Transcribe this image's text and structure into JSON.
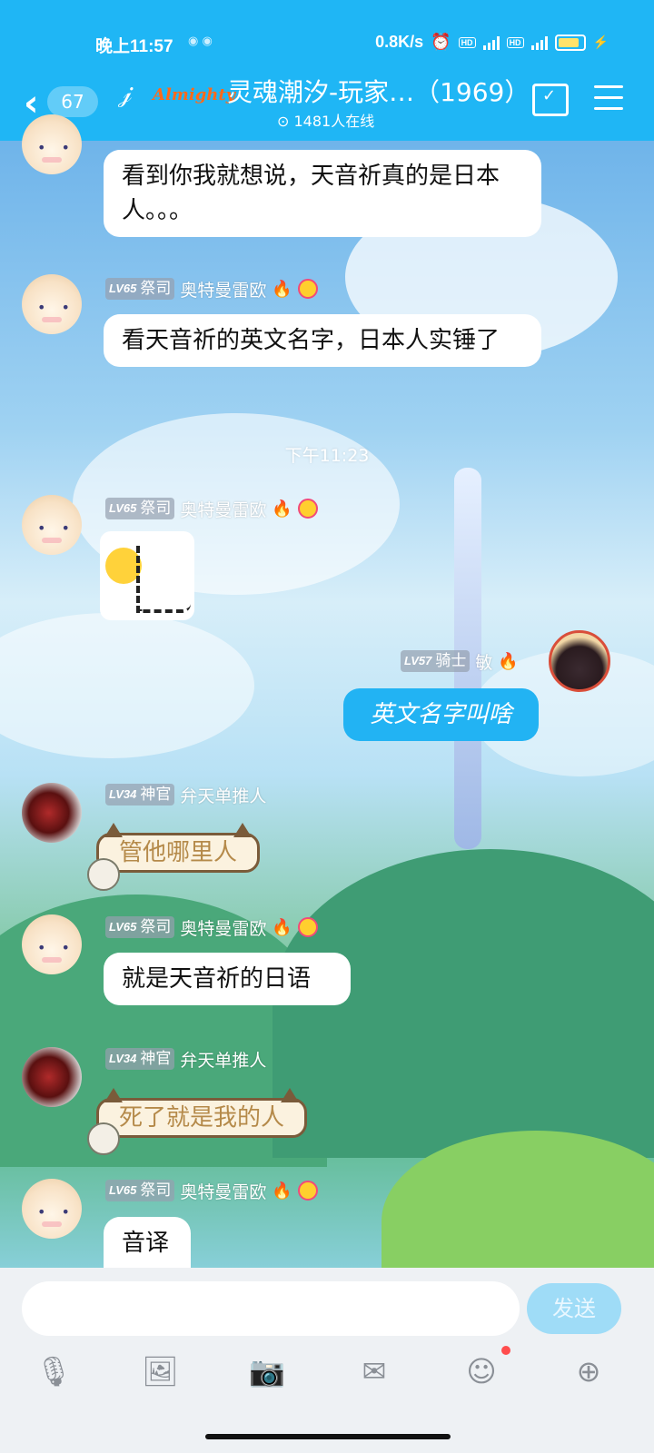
{
  "status_bar": {
    "time": "晚上11:57",
    "network_speed": "0.8K/s",
    "battery_level": "100",
    "icons": [
      "alarm-icon",
      "hd-icon",
      "signal-4g-icon",
      "hd-icon",
      "signal-4g-icon",
      "battery-icon",
      "charging-icon"
    ]
  },
  "header": {
    "unread_count": "67",
    "logo_text": "Almighty",
    "title": "灵魂潮汐-玩家…（1969）",
    "online": "1481人在线"
  },
  "messages": [
    {
      "side": "left",
      "avatar": "bun-avatar",
      "text": "看到你我就想说，天音祈真的是日本人。。。"
    },
    {
      "side": "left",
      "avatar": "bun-avatar",
      "level": "LV65",
      "title": "祭司",
      "name": "奥特曼雷欧",
      "text": "看天音祈的英文名字，日本人实锤了"
    },
    {
      "type": "time",
      "text": "下午11:23"
    },
    {
      "side": "left",
      "avatar": "bun-avatar",
      "level": "LV65",
      "title": "祭司",
      "name": "奥特曼雷欧",
      "sticker": "laughing-sticker"
    },
    {
      "side": "right",
      "avatar": "mushroom-avatar",
      "level": "LV57",
      "title": "骑士",
      "name": "敏",
      "text": "英文名字叫啥"
    },
    {
      "side": "left",
      "avatar": "mech-avatar",
      "level": "LV34",
      "title": "神官",
      "name": "弁天单推人",
      "text": "管他哪里人"
    },
    {
      "side": "left",
      "avatar": "bun-avatar",
      "level": "LV65",
      "title": "祭司",
      "name": "奥特曼雷欧",
      "text": "就是天音祈的日语"
    },
    {
      "side": "left",
      "avatar": "mech-avatar",
      "level": "LV34",
      "title": "神官",
      "name": "弁天单推人",
      "text": "死了就是我的人"
    },
    {
      "side": "left",
      "avatar": "bun-avatar",
      "level": "LV65",
      "title": "祭司",
      "name": "奥特曼雷欧",
      "text": "音译"
    }
  ],
  "input": {
    "placeholder": "",
    "send_label": "发送"
  },
  "toolbar": [
    "microphone-icon",
    "image-icon",
    "camera-icon",
    "red-packet-icon",
    "emoji-icon",
    "plus-icon"
  ],
  "colors": {
    "header": "#1fb6f5",
    "my_bubble": "#22b3f3",
    "cat_bubble_text": "#b58a4a"
  }
}
